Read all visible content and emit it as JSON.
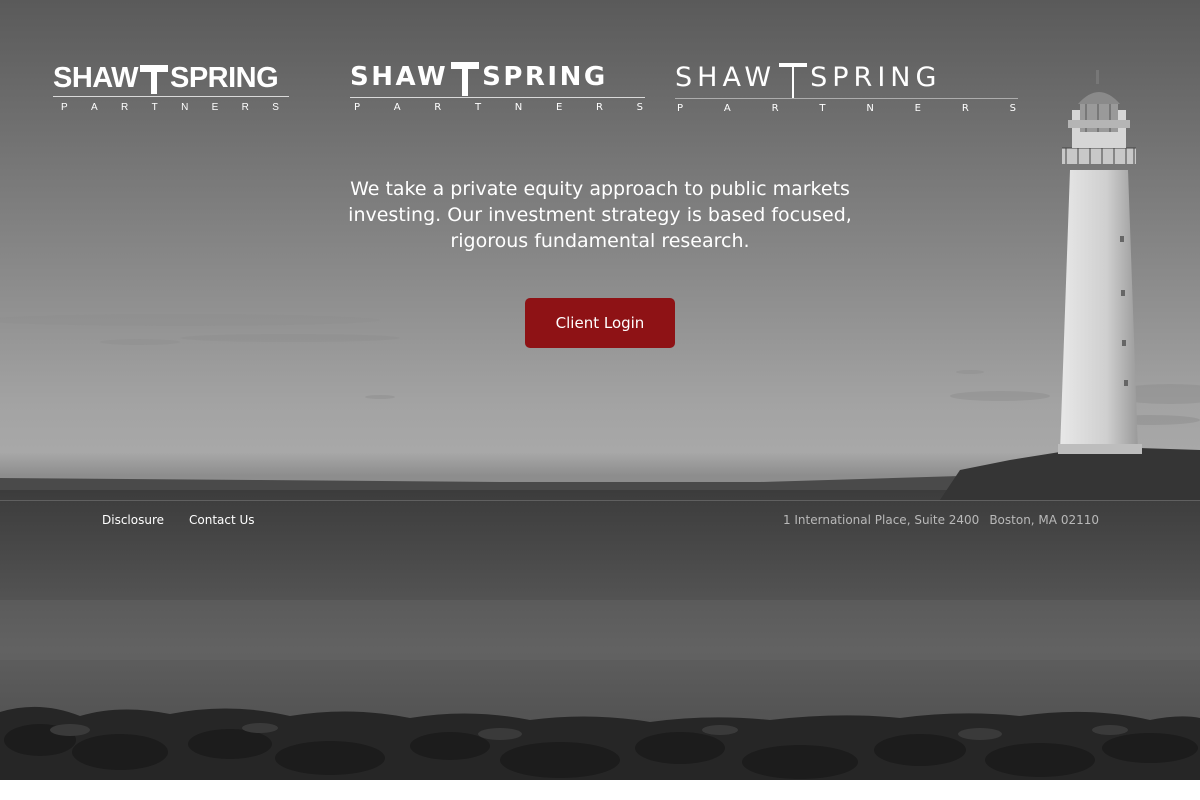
{
  "logos": [
    {
      "brand_left": "SHAW",
      "brand_right": "SPRING",
      "sub": [
        "P",
        "A",
        "R",
        "T",
        "N",
        "E",
        "R",
        "S"
      ]
    },
    {
      "brand_left": "SHAW",
      "brand_right": "SPRING",
      "sub": [
        "P",
        "A",
        "R",
        "T",
        "N",
        "E",
        "R",
        "S"
      ]
    },
    {
      "brand_left": "SHAW",
      "brand_right": "SPRING",
      "sub": [
        "P",
        "A",
        "R",
        "T",
        "N",
        "E",
        "R",
        "S"
      ]
    }
  ],
  "hero": {
    "tagline_lines": [
      "We take a private equity approach to public markets",
      "investing. Our investment strategy is based focused,",
      "rigorous fundamental research."
    ],
    "login_label": "Client Login"
  },
  "footer": {
    "links": [
      "Disclosure",
      "Contact Us"
    ],
    "address_street": "1 International Place, Suite 2400",
    "address_city": "Boston, MA 02110"
  },
  "colors": {
    "button": "#8e1215",
    "text": "#ffffff",
    "address_text": "#b9b9b9"
  },
  "icons": [
    "lighthouse-image",
    "signpost-icon"
  ]
}
